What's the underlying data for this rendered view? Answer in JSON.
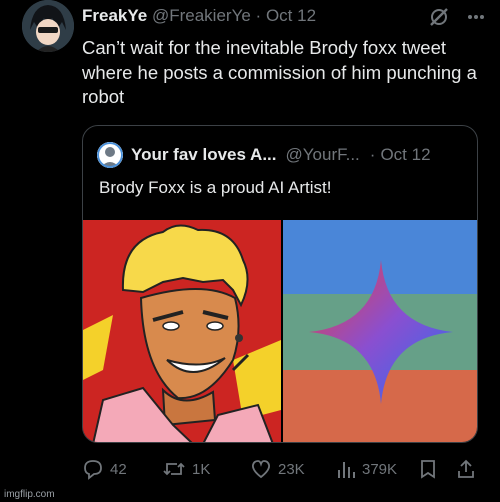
{
  "tweet": {
    "author_name": "FreakYe",
    "author_handle": "@FreakierYe",
    "separator": "·",
    "date": "Oct 12",
    "text": "Can’t wait for the inevitable Brody foxx tweet where he posts a commission of him punching a robot"
  },
  "quoted_tweet": {
    "author_name": "Your fav loves A...",
    "author_handle": "@YourF...",
    "separator": "·",
    "date": "Oct 12",
    "text": "Brody Foxx is a proud AI Artist!"
  },
  "actions": {
    "replies": "42",
    "retweets": "1K",
    "likes": "23K",
    "views": "379K"
  },
  "watermark": "imgflip.com",
  "colors": {
    "background": "#000000",
    "text": "#e7e9ea",
    "muted": "#71767b",
    "border": "#3c4146",
    "art_red": "#cc2522",
    "stripe_blue": "#4a86d8",
    "stripe_teal": "#66a088",
    "stripe_orange": "#d6694a"
  },
  "icons": [
    "grok-icon",
    "more-icon",
    "reply-icon",
    "retweet-icon",
    "like-icon",
    "views-icon",
    "bookmark-icon",
    "share-icon"
  ]
}
